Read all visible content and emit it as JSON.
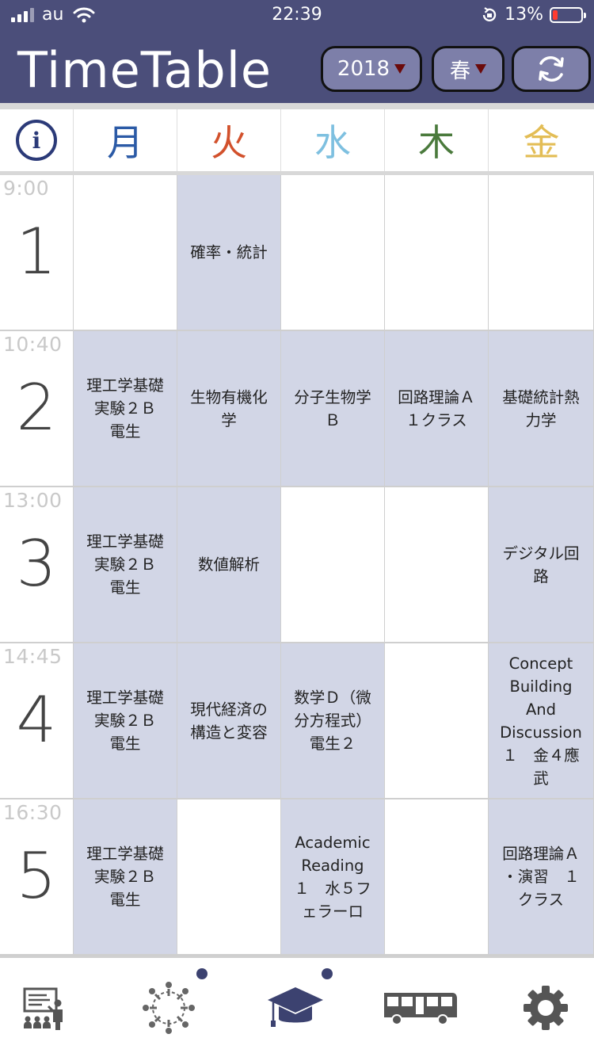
{
  "status_bar": {
    "carrier": "au",
    "time": "22:39",
    "battery": "13%"
  },
  "header": {
    "title": "TimeTable",
    "year": "2018",
    "season": "春",
    "refresh_icon": "refresh-icon"
  },
  "days": [
    {
      "label": "月",
      "color": "#2b5aa6"
    },
    {
      "label": "火",
      "color": "#d2512c"
    },
    {
      "label": "水",
      "color": "#7ec0e0"
    },
    {
      "label": "木",
      "color": "#4a7a3c"
    },
    {
      "label": "金",
      "color": "#e3bd55"
    }
  ],
  "periods": [
    {
      "num": "1",
      "time": "9:00",
      "cells": [
        "",
        "確率・統計",
        "",
        "",
        ""
      ]
    },
    {
      "num": "2",
      "time": "10:40",
      "cells": [
        "理工学基礎\n実験２Ｂ\n電生",
        "生物有機化\n学",
        "分子生物学\nＢ",
        "回路理論Ａ\n１クラス",
        "基礎統計熱\n力学"
      ]
    },
    {
      "num": "3",
      "time": "13:00",
      "cells": [
        "理工学基礎\n実験２Ｂ\n電生",
        "数値解析",
        "",
        "",
        "デジタル回\n路"
      ]
    },
    {
      "num": "4",
      "time": "14:45",
      "cells": [
        "理工学基礎\n実験２Ｂ\n電生",
        "現代経済の\n構造と変容",
        "数学Ｄ（微\n分方程式）\n電生２",
        "",
        "Concept\nBuilding\nAnd\nDiscussion\n１　金４應\n武"
      ]
    },
    {
      "num": "5",
      "time": "16:30",
      "cells": [
        "理工学基礎\n実験２Ｂ\n電生",
        "",
        "Academic\nReading\n１　水５フ\nェラーロ",
        "",
        "回路理論Ａ\n・演習　１\nクラス"
      ]
    }
  ],
  "bottom_nav": [
    {
      "icon": "classroom-icon"
    },
    {
      "icon": "community-icon",
      "badge": true
    },
    {
      "icon": "graduation-cap-icon",
      "badge": true
    },
    {
      "icon": "bus-icon"
    },
    {
      "icon": "gear-icon"
    }
  ],
  "colors": {
    "header": "#4b4e7a",
    "filled_cell": "#d2d6e6",
    "pill": "#7d7fa9"
  }
}
